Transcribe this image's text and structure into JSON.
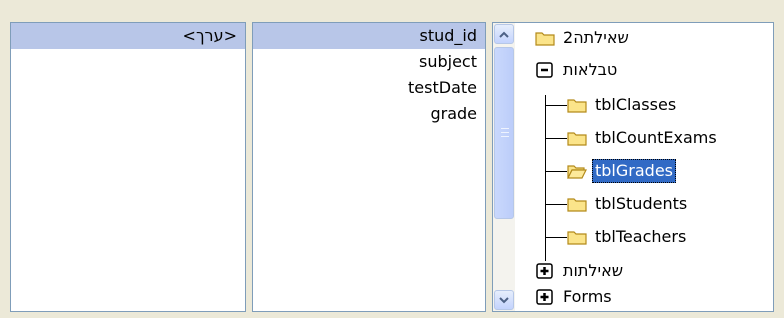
{
  "values_list": {
    "items": [
      "<ערך>"
    ]
  },
  "fields_list": {
    "items": [
      "stud_id",
      "subject",
      "testDate",
      "grade"
    ]
  },
  "tree": {
    "root_query": "שאילתה2",
    "tables_group": "טבלאות",
    "tables": [
      "tblClasses",
      "tblCountExams",
      "tblGrades",
      "tblStudents",
      "tblTeachers"
    ],
    "selected_table": "tblGrades",
    "queries_group": "שאילתות",
    "forms_group": "Forms"
  },
  "colors": {
    "selection_highlight": "#316ac5",
    "row_highlight": "#b8c6e8",
    "folder_fill": "#fbe48a",
    "folder_stroke": "#b38a1a"
  },
  "icons": {
    "folder": "folder-icon",
    "open_folder": "folder-open-icon",
    "collapse": "minus-box-icon",
    "expand": "plus-box-icon",
    "scroll_up": "arrow-up-icon",
    "scroll_down": "arrow-down-icon"
  }
}
